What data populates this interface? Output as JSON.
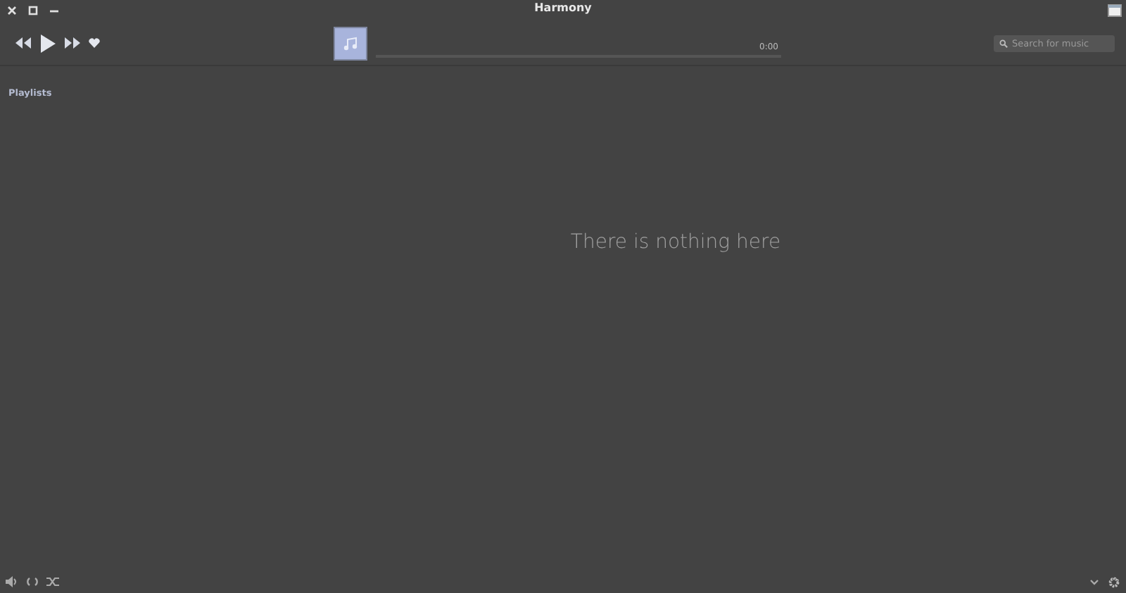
{
  "window": {
    "title": "Harmony"
  },
  "player": {
    "time": "0:00",
    "level": 0
  },
  "search": {
    "placeholder": "Search for music"
  },
  "sidebar": {
    "title": "Playlists"
  },
  "empty_message": "There is nothing here"
}
